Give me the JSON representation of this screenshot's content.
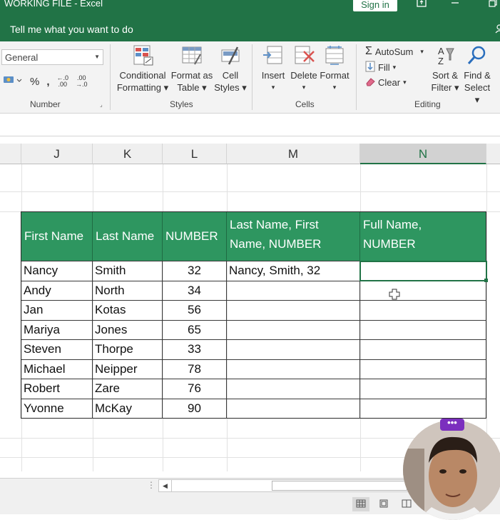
{
  "window": {
    "title": "WORKING FILE  -  Excel",
    "sign_in": "Sign in"
  },
  "tell_me": "Tell me what you want to do",
  "ribbon": {
    "number_format": "General",
    "number_group": "Number",
    "percent": "%",
    "comma": ",",
    "inc_decimal_top": "←.0",
    "inc_decimal_bottom": ".00",
    "dec_decimal_top": ".00",
    "dec_decimal_bottom": "→.0",
    "styles_group": "Styles",
    "conditional_formatting": [
      "Conditional",
      "Formatting ▾"
    ],
    "format_as_table": [
      "Format as",
      "Table ▾"
    ],
    "cell_styles": [
      "Cell",
      "Styles ▾"
    ],
    "cells_group": "Cells",
    "insert": "Insert",
    "delete": "Delete",
    "format": "Format",
    "editing_group": "Editing",
    "autosum": "AutoSum",
    "fill": "Fill",
    "clear": "Clear",
    "sort_filter": [
      "Sort &",
      "Filter ▾"
    ],
    "find_select": [
      "Find &",
      "Select ▾"
    ]
  },
  "columns": [
    "J",
    "K",
    "L",
    "M",
    "N"
  ],
  "table": {
    "headers": [
      "First Name",
      "Last Name",
      "NUMBER",
      "Last Name, First Name, NUMBER",
      "Full Name, NUMBER"
    ],
    "header_lines": {
      "m": [
        "Last Name, First",
        "Name, NUMBER"
      ],
      "n": [
        "Full Name,",
        "NUMBER"
      ]
    },
    "rows": [
      {
        "first": "Nancy",
        "last": "Smith",
        "number": "32",
        "combined": "Nancy, Smith, 32",
        "full": ""
      },
      {
        "first": "Andy",
        "last": "North",
        "number": "34",
        "combined": "",
        "full": ""
      },
      {
        "first": "Jan",
        "last": "Kotas",
        "number": "56",
        "combined": "",
        "full": ""
      },
      {
        "first": "Mariya",
        "last": "Jones",
        "number": "65",
        "combined": "",
        "full": ""
      },
      {
        "first": "Steven",
        "last": "Thorpe",
        "number": "33",
        "combined": "",
        "full": ""
      },
      {
        "first": "Michael",
        "last": "Neipper",
        "number": "78",
        "combined": "",
        "full": ""
      },
      {
        "first": "Robert",
        "last": "Zare",
        "number": "76",
        "combined": "",
        "full": ""
      },
      {
        "first": "Yvonne",
        "last": "McKay",
        "number": "90",
        "combined": "",
        "full": ""
      }
    ]
  },
  "overlay": {
    "more_label": "•••"
  },
  "colors": {
    "excel_green": "#217346",
    "header_fill": "#2e9660",
    "accent_purple": "#7b2fbe"
  }
}
